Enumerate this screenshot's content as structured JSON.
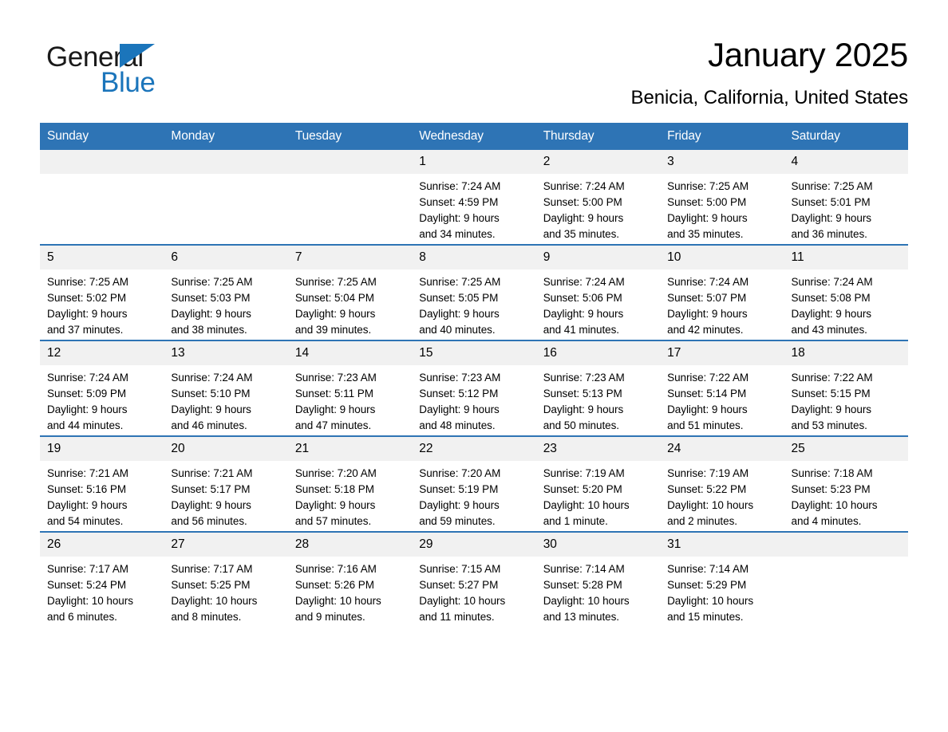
{
  "brand": {
    "name_part1": "General",
    "name_part2": "Blue",
    "flag_icon": "triangle-flag-icon",
    "accent_color": "#1b75bb"
  },
  "header": {
    "month_title": "January 2025",
    "location": "Benicia, California, United States"
  },
  "theme": {
    "header_blue": "#2e74b5",
    "daynum_gray": "#f1f1f1",
    "text_black": "#000000"
  },
  "calendar": {
    "weekday_headers": [
      "Sunday",
      "Monday",
      "Tuesday",
      "Wednesday",
      "Thursday",
      "Friday",
      "Saturday"
    ],
    "weeks": [
      [
        {
          "empty": true,
          "day": ""
        },
        {
          "empty": true,
          "day": ""
        },
        {
          "empty": true,
          "day": ""
        },
        {
          "day": "1",
          "sunrise": "Sunrise: 7:24 AM",
          "sunset": "Sunset: 4:59 PM",
          "daylight_line1": "Daylight: 9 hours",
          "daylight_line2": "and 34 minutes."
        },
        {
          "day": "2",
          "sunrise": "Sunrise: 7:24 AM",
          "sunset": "Sunset: 5:00 PM",
          "daylight_line1": "Daylight: 9 hours",
          "daylight_line2": "and 35 minutes."
        },
        {
          "day": "3",
          "sunrise": "Sunrise: 7:25 AM",
          "sunset": "Sunset: 5:00 PM",
          "daylight_line1": "Daylight: 9 hours",
          "daylight_line2": "and 35 minutes."
        },
        {
          "day": "4",
          "sunrise": "Sunrise: 7:25 AM",
          "sunset": "Sunset: 5:01 PM",
          "daylight_line1": "Daylight: 9 hours",
          "daylight_line2": "and 36 minutes."
        }
      ],
      [
        {
          "day": "5",
          "sunrise": "Sunrise: 7:25 AM",
          "sunset": "Sunset: 5:02 PM",
          "daylight_line1": "Daylight: 9 hours",
          "daylight_line2": "and 37 minutes."
        },
        {
          "day": "6",
          "sunrise": "Sunrise: 7:25 AM",
          "sunset": "Sunset: 5:03 PM",
          "daylight_line1": "Daylight: 9 hours",
          "daylight_line2": "and 38 minutes."
        },
        {
          "day": "7",
          "sunrise": "Sunrise: 7:25 AM",
          "sunset": "Sunset: 5:04 PM",
          "daylight_line1": "Daylight: 9 hours",
          "daylight_line2": "and 39 minutes."
        },
        {
          "day": "8",
          "sunrise": "Sunrise: 7:25 AM",
          "sunset": "Sunset: 5:05 PM",
          "daylight_line1": "Daylight: 9 hours",
          "daylight_line2": "and 40 minutes."
        },
        {
          "day": "9",
          "sunrise": "Sunrise: 7:24 AM",
          "sunset": "Sunset: 5:06 PM",
          "daylight_line1": "Daylight: 9 hours",
          "daylight_line2": "and 41 minutes."
        },
        {
          "day": "10",
          "sunrise": "Sunrise: 7:24 AM",
          "sunset": "Sunset: 5:07 PM",
          "daylight_line1": "Daylight: 9 hours",
          "daylight_line2": "and 42 minutes."
        },
        {
          "day": "11",
          "sunrise": "Sunrise: 7:24 AM",
          "sunset": "Sunset: 5:08 PM",
          "daylight_line1": "Daylight: 9 hours",
          "daylight_line2": "and 43 minutes."
        }
      ],
      [
        {
          "day": "12",
          "sunrise": "Sunrise: 7:24 AM",
          "sunset": "Sunset: 5:09 PM",
          "daylight_line1": "Daylight: 9 hours",
          "daylight_line2": "and 44 minutes."
        },
        {
          "day": "13",
          "sunrise": "Sunrise: 7:24 AM",
          "sunset": "Sunset: 5:10 PM",
          "daylight_line1": "Daylight: 9 hours",
          "daylight_line2": "and 46 minutes."
        },
        {
          "day": "14",
          "sunrise": "Sunrise: 7:23 AM",
          "sunset": "Sunset: 5:11 PM",
          "daylight_line1": "Daylight: 9 hours",
          "daylight_line2": "and 47 minutes."
        },
        {
          "day": "15",
          "sunrise": "Sunrise: 7:23 AM",
          "sunset": "Sunset: 5:12 PM",
          "daylight_line1": "Daylight: 9 hours",
          "daylight_line2": "and 48 minutes."
        },
        {
          "day": "16",
          "sunrise": "Sunrise: 7:23 AM",
          "sunset": "Sunset: 5:13 PM",
          "daylight_line1": "Daylight: 9 hours",
          "daylight_line2": "and 50 minutes."
        },
        {
          "day": "17",
          "sunrise": "Sunrise: 7:22 AM",
          "sunset": "Sunset: 5:14 PM",
          "daylight_line1": "Daylight: 9 hours",
          "daylight_line2": "and 51 minutes."
        },
        {
          "day": "18",
          "sunrise": "Sunrise: 7:22 AM",
          "sunset": "Sunset: 5:15 PM",
          "daylight_line1": "Daylight: 9 hours",
          "daylight_line2": "and 53 minutes."
        }
      ],
      [
        {
          "day": "19",
          "sunrise": "Sunrise: 7:21 AM",
          "sunset": "Sunset: 5:16 PM",
          "daylight_line1": "Daylight: 9 hours",
          "daylight_line2": "and 54 minutes."
        },
        {
          "day": "20",
          "sunrise": "Sunrise: 7:21 AM",
          "sunset": "Sunset: 5:17 PM",
          "daylight_line1": "Daylight: 9 hours",
          "daylight_line2": "and 56 minutes."
        },
        {
          "day": "21",
          "sunrise": "Sunrise: 7:20 AM",
          "sunset": "Sunset: 5:18 PM",
          "daylight_line1": "Daylight: 9 hours",
          "daylight_line2": "and 57 minutes."
        },
        {
          "day": "22",
          "sunrise": "Sunrise: 7:20 AM",
          "sunset": "Sunset: 5:19 PM",
          "daylight_line1": "Daylight: 9 hours",
          "daylight_line2": "and 59 minutes."
        },
        {
          "day": "23",
          "sunrise": "Sunrise: 7:19 AM",
          "sunset": "Sunset: 5:20 PM",
          "daylight_line1": "Daylight: 10 hours",
          "daylight_line2": "and 1 minute."
        },
        {
          "day": "24",
          "sunrise": "Sunrise: 7:19 AM",
          "sunset": "Sunset: 5:22 PM",
          "daylight_line1": "Daylight: 10 hours",
          "daylight_line2": "and 2 minutes."
        },
        {
          "day": "25",
          "sunrise": "Sunrise: 7:18 AM",
          "sunset": "Sunset: 5:23 PM",
          "daylight_line1": "Daylight: 10 hours",
          "daylight_line2": "and 4 minutes."
        }
      ],
      [
        {
          "day": "26",
          "sunrise": "Sunrise: 7:17 AM",
          "sunset": "Sunset: 5:24 PM",
          "daylight_line1": "Daylight: 10 hours",
          "daylight_line2": "and 6 minutes."
        },
        {
          "day": "27",
          "sunrise": "Sunrise: 7:17 AM",
          "sunset": "Sunset: 5:25 PM",
          "daylight_line1": "Daylight: 10 hours",
          "daylight_line2": "and 8 minutes."
        },
        {
          "day": "28",
          "sunrise": "Sunrise: 7:16 AM",
          "sunset": "Sunset: 5:26 PM",
          "daylight_line1": "Daylight: 10 hours",
          "daylight_line2": "and 9 minutes."
        },
        {
          "day": "29",
          "sunrise": "Sunrise: 7:15 AM",
          "sunset": "Sunset: 5:27 PM",
          "daylight_line1": "Daylight: 10 hours",
          "daylight_line2": "and 11 minutes."
        },
        {
          "day": "30",
          "sunrise": "Sunrise: 7:14 AM",
          "sunset": "Sunset: 5:28 PM",
          "daylight_line1": "Daylight: 10 hours",
          "daylight_line2": "and 13 minutes."
        },
        {
          "day": "31",
          "sunrise": "Sunrise: 7:14 AM",
          "sunset": "Sunset: 5:29 PM",
          "daylight_line1": "Daylight: 10 hours",
          "daylight_line2": "and 15 minutes."
        },
        {
          "empty": true,
          "day": ""
        }
      ]
    ]
  }
}
